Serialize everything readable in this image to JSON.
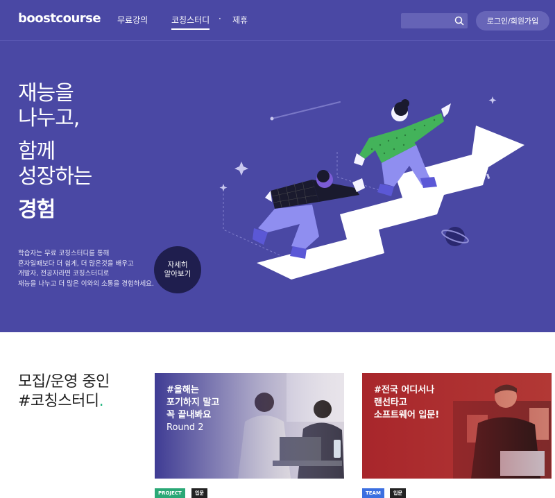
{
  "header": {
    "logo": "boostcourse",
    "nav": [
      {
        "label": "무료강의"
      },
      {
        "label": "코칭스터디"
      },
      {
        "label": "제휴"
      }
    ],
    "nav_separator": "·",
    "search": {
      "placeholder": "",
      "value": ""
    },
    "login_label": "로그인/회원가입"
  },
  "hero": {
    "headline_lines": [
      "재능을",
      "나누고,",
      "함께",
      "성장하는",
      "경험"
    ],
    "description_lines": [
      "학습자는 무료 코칭스터디를 통해",
      "혼자일때보다 더 쉽게, 더 많은것을 배우고",
      "개발자, 전공자라면 코칭스터디로",
      "재능을 나누고 더 많은 이와의 소통을 경험하세요."
    ],
    "more_button": [
      "자세히",
      "알아보기"
    ]
  },
  "section": {
    "title_line1": "모집/운영 중인",
    "title_line2": "#코칭스터디",
    "title_dot": "."
  },
  "cards": [
    {
      "lines": [
        "#올해는",
        "포기하지 말고",
        "꼭 끝내봐요",
        "Round 2"
      ],
      "tags": [
        "PROJECT",
        "입문"
      ],
      "tag_colors": [
        "#2aa876",
        "#222222"
      ]
    },
    {
      "lines": [
        "#전국 어디서나",
        "랜선타고",
        "소프트웨어 입문!"
      ],
      "tags": [
        "TEAM",
        "입문"
      ],
      "tag_colors": [
        "#3b6fe0",
        "#222222"
      ]
    }
  ],
  "colors": {
    "brand_purple": "#4a48a4",
    "dark_navy": "#1f1e4e",
    "accent_green": "#1bb47c",
    "card2_red": "#a8262b"
  }
}
